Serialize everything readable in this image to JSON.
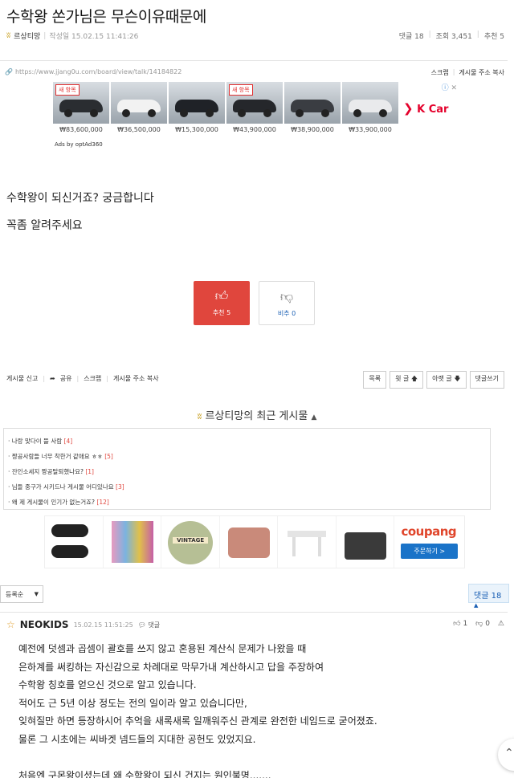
{
  "post": {
    "title": "수학왕 쏜가님은 무슨이유때문에",
    "author": "르상티망",
    "date_label": "작성일 15.02.15 11:41:26",
    "comments_label": "댓글 18",
    "views_label": "조회 3,451",
    "recommend_label": "추천 5",
    "url": "https://www.jjang0u.com/board/view/talk/14184822",
    "scrap": "스크랩",
    "copy_url": "게시물 주소 복사",
    "body": [
      "수학왕이 되신거죠? 궁금합니다",
      "꼭좀 알려주세요"
    ]
  },
  "ad_top": {
    "cars": [
      {
        "price": "₩83,600,000",
        "badge": "새 항목",
        "color": "#2a2d31"
      },
      {
        "price": "₩36,500,000",
        "badge": "",
        "color": "#f2f2f2"
      },
      {
        "price": "₩15,300,000",
        "badge": "",
        "color": "#1f2227"
      },
      {
        "price": "₩43,900,000",
        "badge": "새 항목",
        "color": "#25272b"
      },
      {
        "price": "₩38,900,000",
        "badge": "",
        "color": "#3a3d42"
      },
      {
        "price": "₩33,900,000",
        "badge": "",
        "color": "#e9eaec"
      }
    ],
    "brand": "K Car",
    "ads_by": "Ads by optAd360"
  },
  "votes": {
    "up_label": "추천 5",
    "down_label": "비추 0"
  },
  "toolbar": {
    "report": "게시물 신고",
    "share": "공유",
    "scrap": "스크랩",
    "copy_url": "게시물 주소 복사",
    "list": "목록",
    "prev": "윗 글",
    "next": "아랫 글",
    "write": "댓글쓰기"
  },
  "recent": {
    "title": "르상티망의 최근 게시물",
    "items": [
      {
        "text": "나랑 맞다이 뜰 사람",
        "count": "[4]"
      },
      {
        "text": "짱공사람들 너무 착한거 같애요 ㅎㅎ",
        "count": "[5]"
      },
      {
        "text": "잔인소세지 짱공탈퇴했나요?",
        "count": "[1]"
      },
      {
        "text": "님들 중구가 시키드나 게시물 어디있나요",
        "count": "[3]"
      },
      {
        "text": "왜 제 게시물이 인기가 없는거죠?",
        "count": "[12]"
      }
    ]
  },
  "ad_bottom": {
    "logo": "coupang",
    "button": "주문하기 >",
    "vintage_label": "VINTAGE"
  },
  "comments_bar": {
    "sort": "등록순",
    "count": "댓글 18"
  },
  "comment": {
    "nick": "NEOKIDS",
    "date": "15.02.15 11:51:25",
    "reply": "댓글",
    "likes": "1",
    "dislikes": "0",
    "lines": [
      "예전에 덧셈과 곱셈이 괄호를 쓰지 않고 혼용된 계산식 문제가 나왔을 때",
      "은하계를 써킹하는 자신감으로 차례대로 막무가내 계산하시고 답을 주장하여",
      "수학왕 칭호를 얻으신 것으로 알고 있습니다.",
      "적어도 근 5년 이상 정도는 전의 일이라 알고 있습니다만,",
      "잊혀질만 하면 등장하시어 추억을 새록새록 일깨워주신 관계로 완전한 네임드로 굳어졌죠.",
      "물론 그 시초에는 씨바겟 넴드들의 지대한 공헌도 있었지요.",
      "",
      "처음엔 구몬왕이셨는데 왜 수학왕이 되신 건지는 원인불명......."
    ]
  }
}
